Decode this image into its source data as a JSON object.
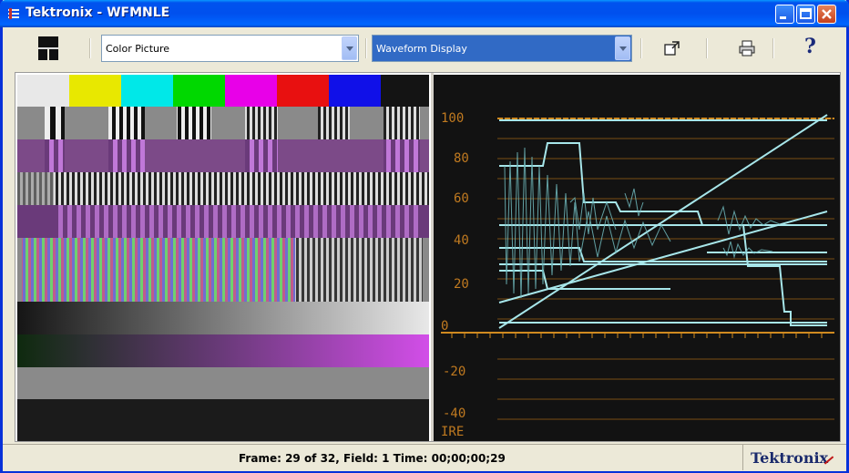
{
  "window": {
    "title": "Tektronix - WFMNLE"
  },
  "toolbar": {
    "left_select": {
      "value": "Color Picture"
    },
    "right_select": {
      "value": "Waveform Display"
    },
    "icons": [
      "layout-icon",
      "popout-icon",
      "print-icon",
      "help-icon"
    ],
    "help_label": "?"
  },
  "waveform": {
    "scale_labels": [
      "100",
      "80",
      "60",
      "40",
      "20",
      "0",
      "-20",
      "-40"
    ],
    "unit": "IRE",
    "trace_color": "#a7e6ea",
    "scale_color": "#c07a20"
  },
  "picture": {
    "color_bars": [
      "#e8e8e8",
      "#e8e800",
      "#00e8e8",
      "#00d800",
      "#e800e8",
      "#e81010",
      "#1010e8",
      "#141414"
    ]
  },
  "statusbar": {
    "text": "Frame: 29 of 32,  Field: 1   Time: 00;00;00;29",
    "logo": "Tektronix"
  }
}
